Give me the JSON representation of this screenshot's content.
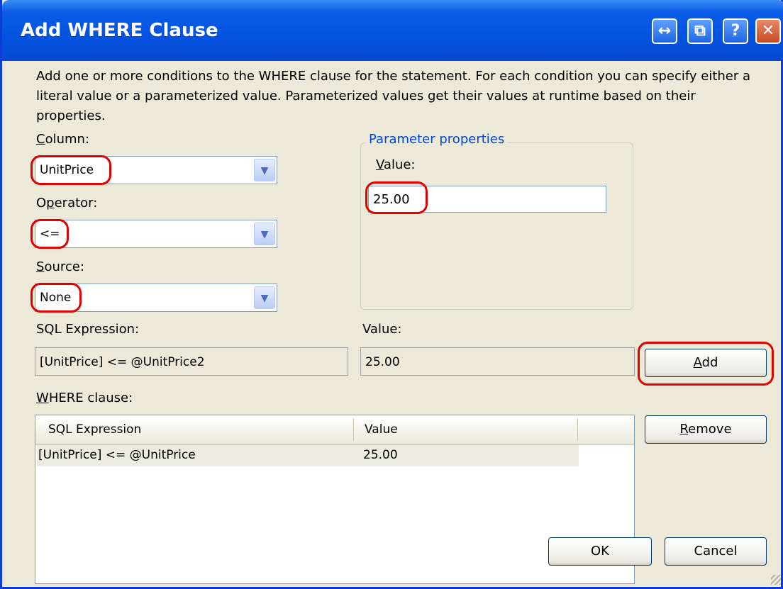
{
  "window": {
    "title": "Add WHERE Clause",
    "buttons": {
      "restore": "↔",
      "minimize": "⧉",
      "help": "?",
      "close": "✕"
    }
  },
  "intro": "Add one or more conditions to the WHERE clause for the statement. For each condition you can specify either a literal value or a parameterized value. Parameterized values get their values at runtime based on their properties.",
  "column": {
    "label_key": "C",
    "label_rest": "olumn:",
    "value": "UnitPrice"
  },
  "operator": {
    "label_pre": "O",
    "label_key": "p",
    "label_rest": "erator:",
    "value": "<="
  },
  "source": {
    "label_key": "S",
    "label_rest": "ource:",
    "value": "None"
  },
  "param": {
    "group_title": "Parameter properties",
    "value_label_key": "V",
    "value_label_rest": "alue:",
    "value": "25.00"
  },
  "sql_expression": {
    "label": "SQL Expression:",
    "value": "[UnitPrice] <= @UnitPrice2"
  },
  "expr_value": {
    "label": "Value:",
    "value": "25.00"
  },
  "buttons": {
    "add_key": "A",
    "add_rest": "dd",
    "remove_key": "R",
    "remove_rest": "emove",
    "ok": "OK",
    "cancel": "Cancel"
  },
  "where": {
    "label_key": "W",
    "label_rest": "HERE clause:",
    "columns": [
      "SQL Expression",
      "Value"
    ],
    "rows": [
      {
        "expression": "[UnitPrice] <= @UnitPrice",
        "value": "25.00"
      }
    ]
  },
  "colors": {
    "titlebar": "#0453e0",
    "highlight": "#e10000",
    "dialog": "#ece9d8"
  }
}
